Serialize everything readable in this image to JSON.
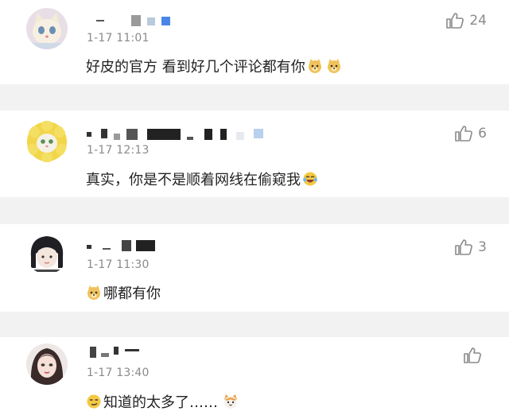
{
  "comments": [
    {
      "time": "1-17 11:01",
      "text": "好皮的官方 看到好几个评论都有你",
      "likes": "24",
      "avatar_icon": "cat-avatar",
      "emojis": [
        "doge-emoji",
        "doge-emoji"
      ]
    },
    {
      "time": "1-17 12:13",
      "text": "真实，你是不是顺着网线在偷窥我",
      "likes": "6",
      "avatar_icon": "flower-cat-avatar",
      "emojis": [
        "laugh-cry-emoji"
      ]
    },
    {
      "time": "1-17 11:30",
      "text": "哪都有你",
      "likes": "3",
      "avatar_icon": "anime-girl-avatar",
      "emojis": [
        "doge-emoji"
      ]
    },
    {
      "time": "1-17 13:40",
      "text": "知道的太多了……",
      "likes": "",
      "avatar_icon": "girl-avatar",
      "emojis": [
        "smirk-emoji",
        "cat-emoji"
      ]
    }
  ],
  "colors": {
    "background": "#f2f2f2",
    "card": "#ffffff",
    "text": "#222222",
    "meta": "#8a8a8a"
  }
}
